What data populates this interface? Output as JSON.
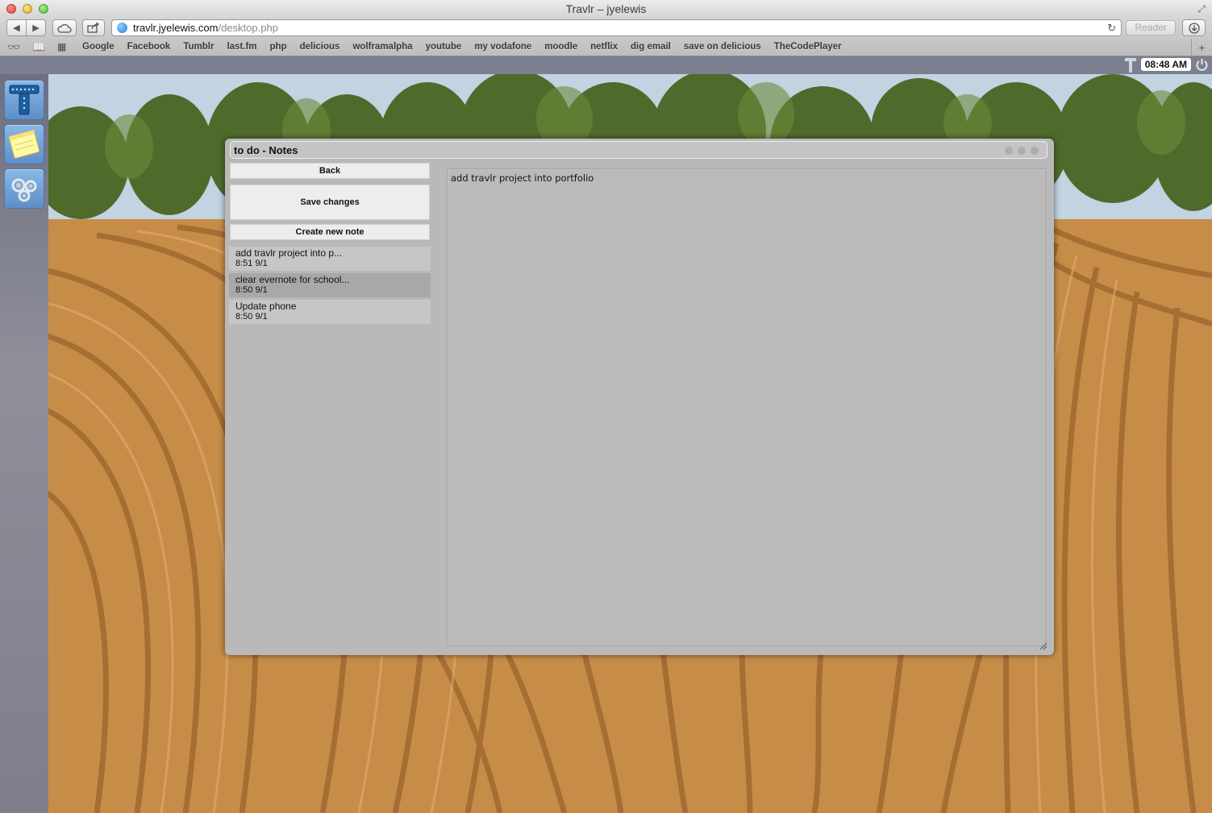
{
  "browser": {
    "window_title": "Travlr – jyelewis",
    "url_host": "travlr.jyelewis.com",
    "url_path": "/desktop.php",
    "reader_label": "Reader",
    "bookmarks": [
      "Google",
      "Facebook",
      "Tumblr",
      "last.fm",
      "php",
      "delicious",
      "wolframalpha",
      "youtube",
      "my vodafone",
      "moodle",
      "netflix",
      "dig email",
      "save on delicious",
      "TheCodePlayer"
    ]
  },
  "topbar": {
    "clock": "08:48 AM"
  },
  "notes_window": {
    "title": "to do - Notes",
    "back_label": "Back",
    "save_label": "Save changes",
    "create_label": "Create new note",
    "notes": [
      {
        "title": "add travlr project into p...",
        "date": "8:51 9/1"
      },
      {
        "title": "clear evernote for school...",
        "date": "8:50 9/1"
      },
      {
        "title": "Update phone",
        "date": "8:50 9/1"
      }
    ],
    "editor_text": "add travlr project into portfolio"
  },
  "dock": {
    "apps": [
      "travlr-icon",
      "notes-icon",
      "settings-icon"
    ]
  },
  "colors": {
    "window_bg": "#b9b9b9",
    "button_bg": "#ededed",
    "active_note_bg": "#a8a8a8",
    "dock_accent": "#6a9ad4"
  }
}
